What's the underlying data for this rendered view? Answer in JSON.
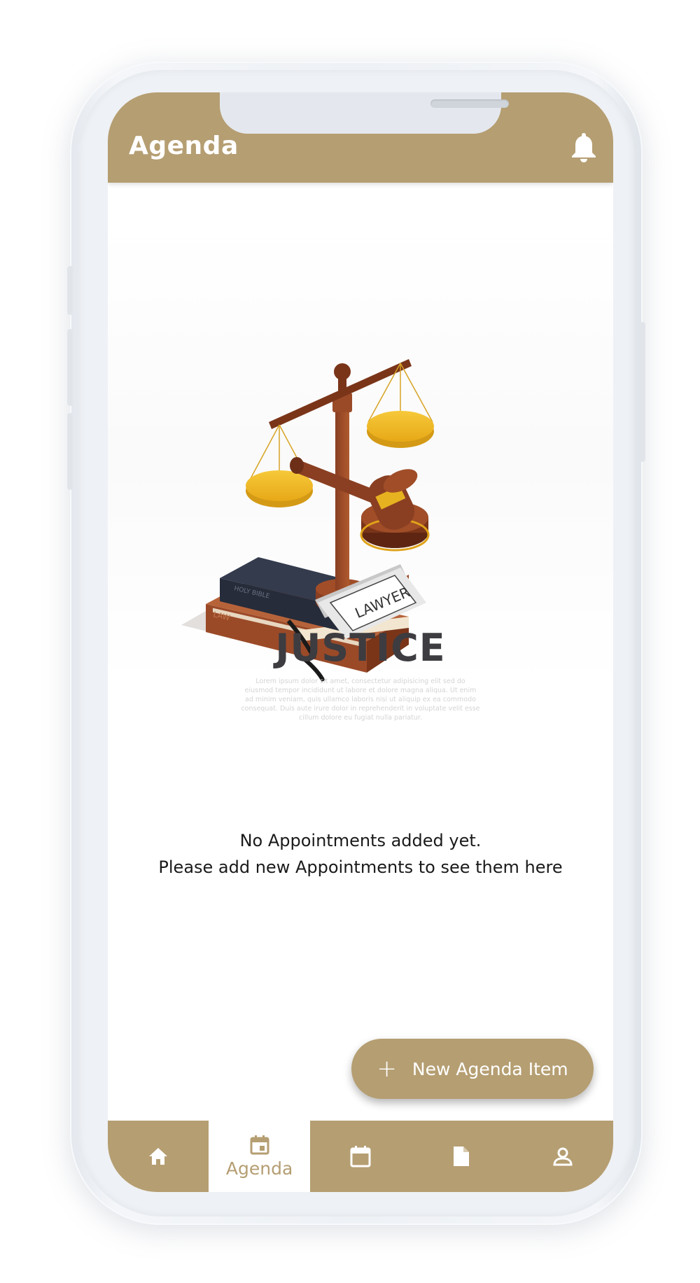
{
  "appbar": {
    "title": "Agenda",
    "notification_icon": "bell-icon"
  },
  "illustration": {
    "heading": "JUSTICE",
    "book_top_label": "HOLY BIBLE",
    "book_bottom_label": "LAW",
    "sign_label": "LAWYER",
    "lorem": "Lorem ipsum dolor sit amet, consectetur adipisicing elit sed do eiusmod tempor incididunt ut labore et dolore magna aliqua. Ut enim ad minim veniam, quis ullamco laboris nisi ut aliquip ex ea commodo consequat. Duis aute irure dolor in reprehenderit in voluptate velit esse cillum dolore eu fugiat nulla pariatur."
  },
  "empty_state": {
    "line1": "No Appointments added yet.",
    "line2": "Please add new Appointments to see them here"
  },
  "fab": {
    "icon": "plus-icon",
    "label": "New Agenda Item"
  },
  "bottom_nav": {
    "active_index": 1,
    "items": [
      {
        "icon": "home-icon",
        "label": ""
      },
      {
        "icon": "event-icon",
        "label": "Agenda"
      },
      {
        "icon": "calendar-icon",
        "label": ""
      },
      {
        "icon": "document-icon",
        "label": ""
      },
      {
        "icon": "person-icon",
        "label": ""
      }
    ]
  },
  "colors": {
    "primary": "#b59e72",
    "background": "#ffffff",
    "text": "#1a1a1a",
    "heading": "#3d3c40"
  }
}
